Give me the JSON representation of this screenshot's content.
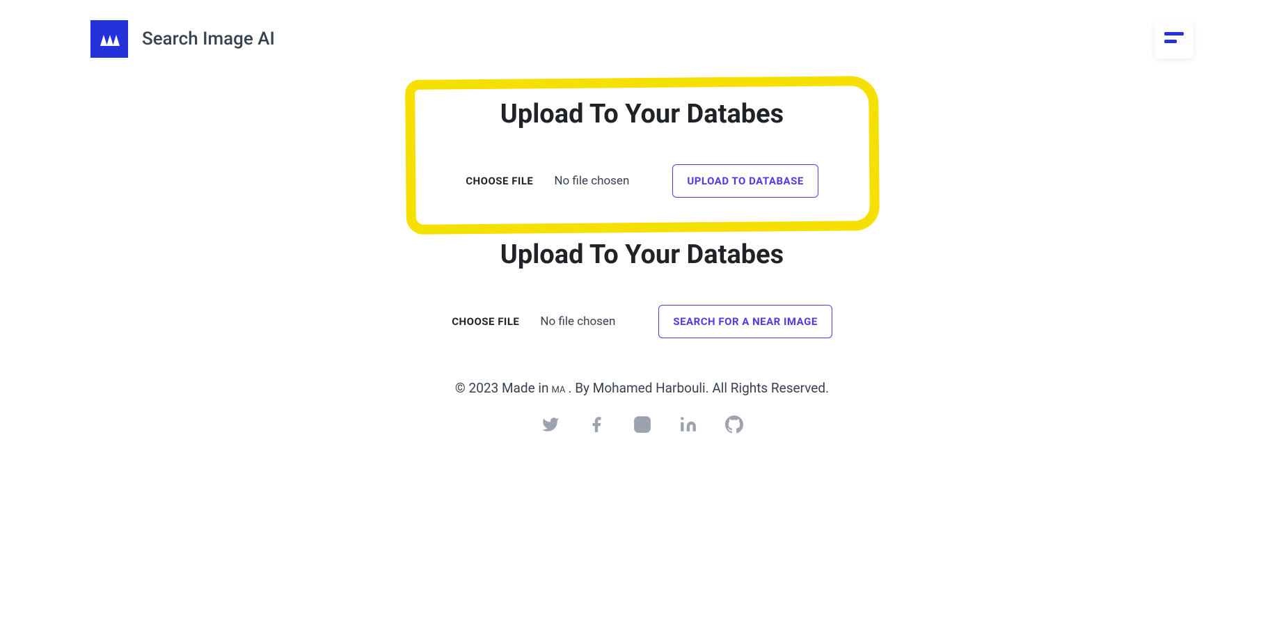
{
  "header": {
    "title": "Search Image AI"
  },
  "section1": {
    "title": "Upload To Your Databes",
    "choose_label": "CHOOSE FILE",
    "file_status": "No file chosen",
    "button_label": "UPLOAD TO DATABASE"
  },
  "section2": {
    "title": "Upload To Your Databes",
    "choose_label": "CHOOSE FILE",
    "file_status": "No file chosen",
    "button_label": "SEARCH FOR A NEAR IMAGE"
  },
  "footer": {
    "copyright_prefix": "© 2023 Made in",
    "country_code": "MA",
    "copyright_suffix": ". By Mohamed Harbouli. All Rights Reserved."
  }
}
